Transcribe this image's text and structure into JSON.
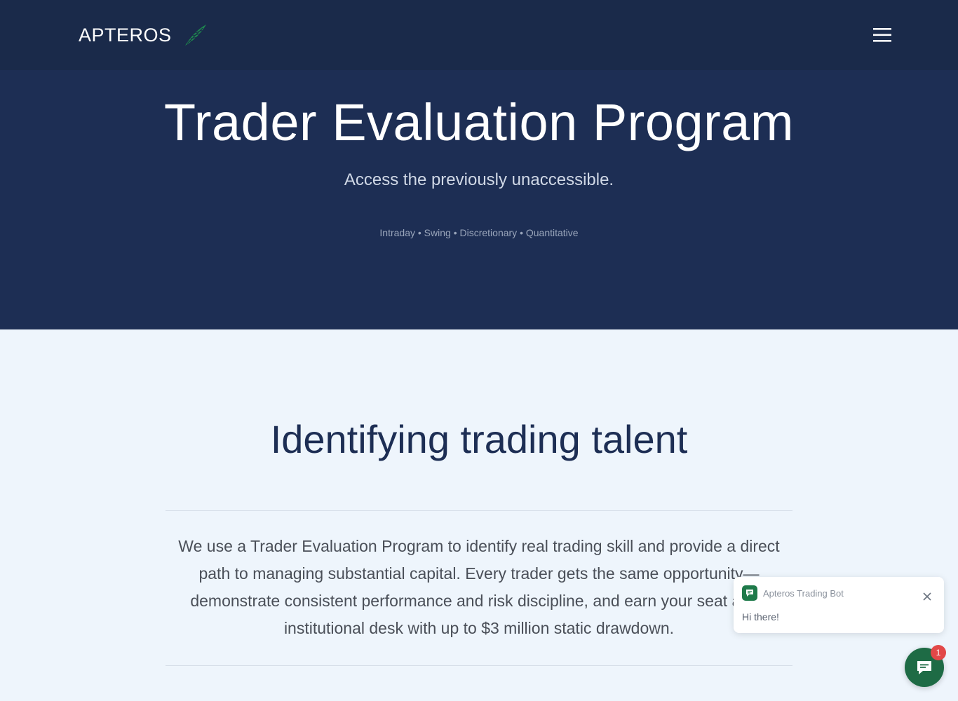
{
  "header": {
    "brand": "APTEROS",
    "logo_icon": "wing-feather-icon",
    "menu_icon": "hamburger-menu-icon"
  },
  "hero": {
    "title": "Trader Evaluation Program",
    "subtitle": "Access the previously unaccessible.",
    "tags": "Intraday • Swing • Discretionary • Quantitative"
  },
  "section": {
    "title": "Identifying trading talent",
    "body": "We use a Trader Evaluation Program to identify real trading skill and provide a direct path to managing substantial capital. Every trader gets the same opportunity—demonstrate consistent performance and risk discipline, and earn your seat at an institutional desk with up to $3 million static drawdown."
  },
  "chat": {
    "bot_name": "Apteros Trading Bot",
    "message": "Hi there!",
    "badge_count": "1",
    "close_icon": "close-icon",
    "launcher_icon": "chat-bubble-icon"
  },
  "colors": {
    "topbar": "#1a2a4a",
    "hero": "#1d2e54",
    "section_bg": "#eef5fc",
    "accent_green": "#1e6b45",
    "badge_red": "#e24848"
  }
}
